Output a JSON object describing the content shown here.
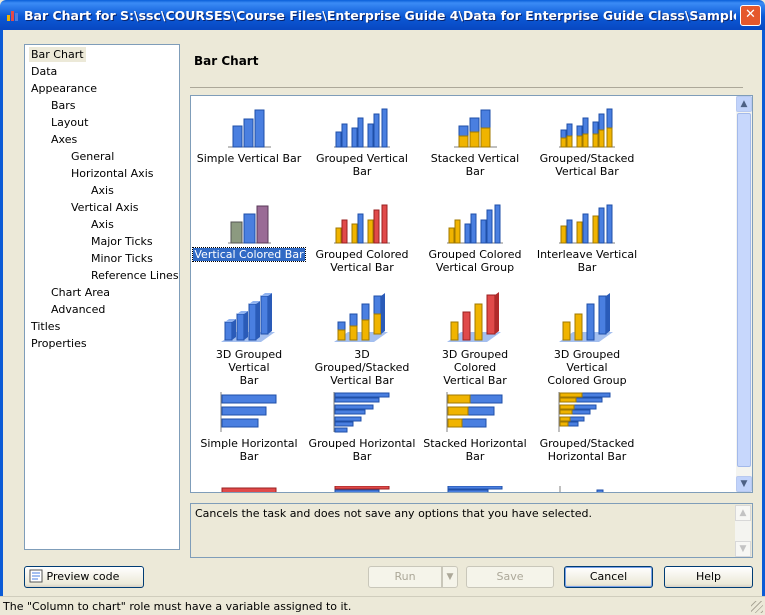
{
  "window": {
    "title": "Bar Chart for S:\\ssc\\COURSES\\Course Files\\Enterprise Guide 4\\Data for Enterprise Guide Class\\Sample Dat...",
    "close_label": "✕"
  },
  "nav": {
    "items": [
      {
        "label": "Bar Chart",
        "level": 0,
        "selected": true
      },
      {
        "label": "Data",
        "level": 0
      },
      {
        "label": "Appearance",
        "level": 0
      },
      {
        "label": "Bars",
        "level": 1
      },
      {
        "label": "Layout",
        "level": 1
      },
      {
        "label": "Axes",
        "level": 1
      },
      {
        "label": "General",
        "level": 2
      },
      {
        "label": "Horizontal Axis",
        "level": 2
      },
      {
        "label": "Axis",
        "level": 3
      },
      {
        "label": "Vertical Axis",
        "level": 2
      },
      {
        "label": "Axis",
        "level": 3
      },
      {
        "label": "Major Ticks",
        "level": 3
      },
      {
        "label": "Minor Ticks",
        "level": 3
      },
      {
        "label": "Reference Lines",
        "level": 3
      },
      {
        "label": "Chart Area",
        "level": 1
      },
      {
        "label": "Advanced",
        "level": 1
      },
      {
        "label": "Titles",
        "level": 0
      },
      {
        "label": "Properties",
        "level": 0
      }
    ]
  },
  "main": {
    "header": "Bar Chart"
  },
  "gallery": {
    "items": [
      {
        "line1": "Simple Vertical Bar",
        "line2": "",
        "icon": "simple-vertical-bar-icon"
      },
      {
        "line1": "Grouped Vertical Bar",
        "line2": "",
        "icon": "grouped-vertical-bar-icon"
      },
      {
        "line1": "Stacked Vertical Bar",
        "line2": "",
        "icon": "stacked-vertical-bar-icon"
      },
      {
        "line1": "Grouped/Stacked",
        "line2": "Vertical Bar",
        "icon": "grouped-stacked-vertical-bar-icon"
      },
      {
        "line1": "Vertical Colored Bar",
        "line2": "",
        "icon": "vertical-colored-bar-icon",
        "selected": true
      },
      {
        "line1": "Grouped Colored",
        "line2": "Vertical Bar",
        "icon": "grouped-colored-vertical-bar-icon"
      },
      {
        "line1": "Grouped Colored",
        "line2": "Vertical Group",
        "icon": "grouped-colored-vertical-group-icon"
      },
      {
        "line1": "Interleave Vertical",
        "line2": "Bar",
        "icon": "interleave-vertical-bar-icon"
      },
      {
        "line1": "3D Grouped Vertical",
        "line2": "Bar",
        "icon": "3d-grouped-vertical-bar-icon"
      },
      {
        "line1": "3D Grouped/Stacked",
        "line2": "Vertical Bar",
        "icon": "3d-grouped-stacked-vertical-bar-icon"
      },
      {
        "line1": "3D Grouped Colored",
        "line2": "Vertical Bar",
        "icon": "3d-grouped-colored-vertical-bar-icon"
      },
      {
        "line1": "3D Grouped Vertical",
        "line2": "Colored Group",
        "icon": "3d-grouped-vertical-colored-group-icon"
      },
      {
        "line1": "Simple Horizontal Bar",
        "line2": "",
        "icon": "simple-horizontal-bar-icon"
      },
      {
        "line1": "Grouped Horizontal",
        "line2": "Bar",
        "icon": "grouped-horizontal-bar-icon"
      },
      {
        "line1": "Stacked Horizontal",
        "line2": "Bar",
        "icon": "stacked-horizontal-bar-icon"
      },
      {
        "line1": "Grouped/Stacked",
        "line2": "Horizontal Bar",
        "icon": "grouped-stacked-horizontal-bar-icon"
      }
    ]
  },
  "description": "Cancels the task and does not save any options that you have selected.",
  "buttons": {
    "preview_label": "Preview code",
    "run_label": "Run",
    "save_label": "Save",
    "cancel_label": "Cancel",
    "help_label": "Help"
  },
  "status": "The \"Column to chart\" role must have a variable assigned to it.",
  "colors": {
    "bar_blue": "#4a7fe0",
    "bar_yellow": "#f0b400",
    "bar_red": "#e04a4a",
    "bar_gray": "#8c9a80",
    "bar_purple": "#9a6b96",
    "selection": "#316ac5",
    "title_blue": "#0b59d6"
  }
}
